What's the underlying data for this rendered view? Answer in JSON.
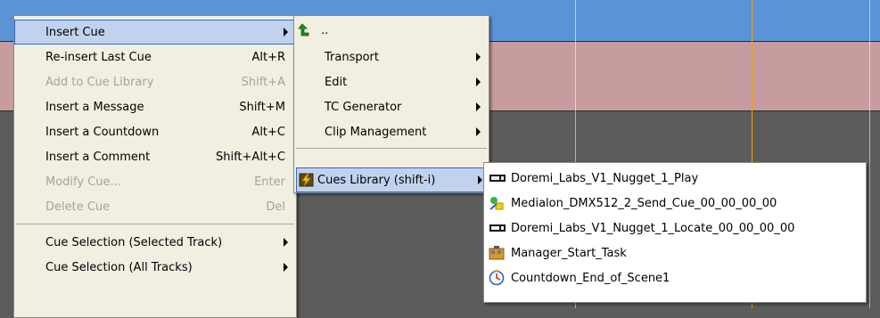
{
  "main_menu": {
    "items": [
      {
        "label": "Insert Cue",
        "shortcut": "",
        "disabled": false,
        "submenu": true
      },
      {
        "label": "Re-insert Last Cue",
        "shortcut": "Alt+R",
        "disabled": false
      },
      {
        "label": "Add to Cue Library",
        "shortcut": "Shift+A",
        "disabled": true
      },
      {
        "label": "Insert a Message",
        "shortcut": "Shift+M",
        "disabled": false
      },
      {
        "label": "Insert a Countdown",
        "shortcut": "Alt+C",
        "disabled": false
      },
      {
        "label": "Insert a Comment",
        "shortcut": "Shift+Alt+C",
        "disabled": false
      },
      {
        "label": "Modify Cue...",
        "shortcut": "Enter",
        "disabled": true
      },
      {
        "label": "Delete Cue",
        "shortcut": "Del",
        "disabled": true
      },
      {
        "label": "Cue Selection (Selected Track)",
        "shortcut": "",
        "disabled": false,
        "submenu": true
      },
      {
        "label": "Cue Selection (All Tracks)",
        "shortcut": "",
        "disabled": false,
        "submenu": true
      }
    ]
  },
  "cue_submenu": {
    "up_label": "..",
    "items": [
      {
        "label": "Transport"
      },
      {
        "label": "Edit"
      },
      {
        "label": "TC Generator"
      },
      {
        "label": "Clip Management"
      },
      {
        "label": "Cues Library (shift-i)"
      }
    ]
  },
  "library_submenu": {
    "items": [
      {
        "label": "Doremi_Labs_V1_Nugget_1_Play",
        "icon": "device-icon"
      },
      {
        "label": "Medialon_DMX512_2_Send_Cue_00_00_00_00",
        "icon": "dmx-icon"
      },
      {
        "label": "Doremi_Labs_V1_Nugget_1_Locate_00_00_00_00",
        "icon": "device-icon"
      },
      {
        "label": "Manager_Start_Task",
        "icon": "manager-icon"
      },
      {
        "label": "Countdown_End_of_Scene1",
        "icon": "clock-icon"
      }
    ]
  },
  "colors": {
    "menu_bg": "#f1efe2",
    "highlight": "#c1d2ee",
    "highlight_border": "#316ac5",
    "timeline_blue": "#5b93d6",
    "timeline_pink": "#c79c9f",
    "timeline_dark": "#5c5c5c",
    "playhead": "#f5a000"
  }
}
